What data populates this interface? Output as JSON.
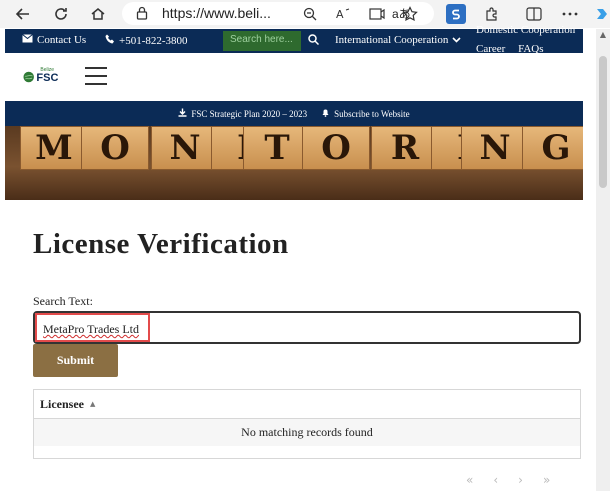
{
  "browser": {
    "url": "https://www.beli...",
    "read_aloud_label": "aあ"
  },
  "topbar": {
    "contact_label": "Contact Us",
    "phone_label": "+501-822-3800",
    "search_placeholder": "Search here...",
    "international_label": "International Cooperation",
    "domestic_label": "Domestic Cooperation",
    "career_label": "Career",
    "faqs_label": "FAQs"
  },
  "header": {
    "logo_top": "Belize",
    "logo_main": "FSC"
  },
  "subnav": {
    "strategic_plan_label": "FSC Strategic Plan 2020 – 2023",
    "subscribe_label": "Subscribe to Website"
  },
  "banner": {
    "letters": [
      "M",
      "O",
      "N",
      "I",
      "T",
      "O",
      "R",
      "I",
      "N",
      "G"
    ]
  },
  "main": {
    "title": "License Verification",
    "search_label": "Search Text:",
    "search_value": "MetaPro Trades Ltd",
    "submit_label": "Submit"
  },
  "table": {
    "column_header": "Licensee",
    "empty_message": "No matching records found"
  },
  "pagination": {
    "first": "«",
    "prev": "‹",
    "next": "›",
    "last": "»"
  }
}
